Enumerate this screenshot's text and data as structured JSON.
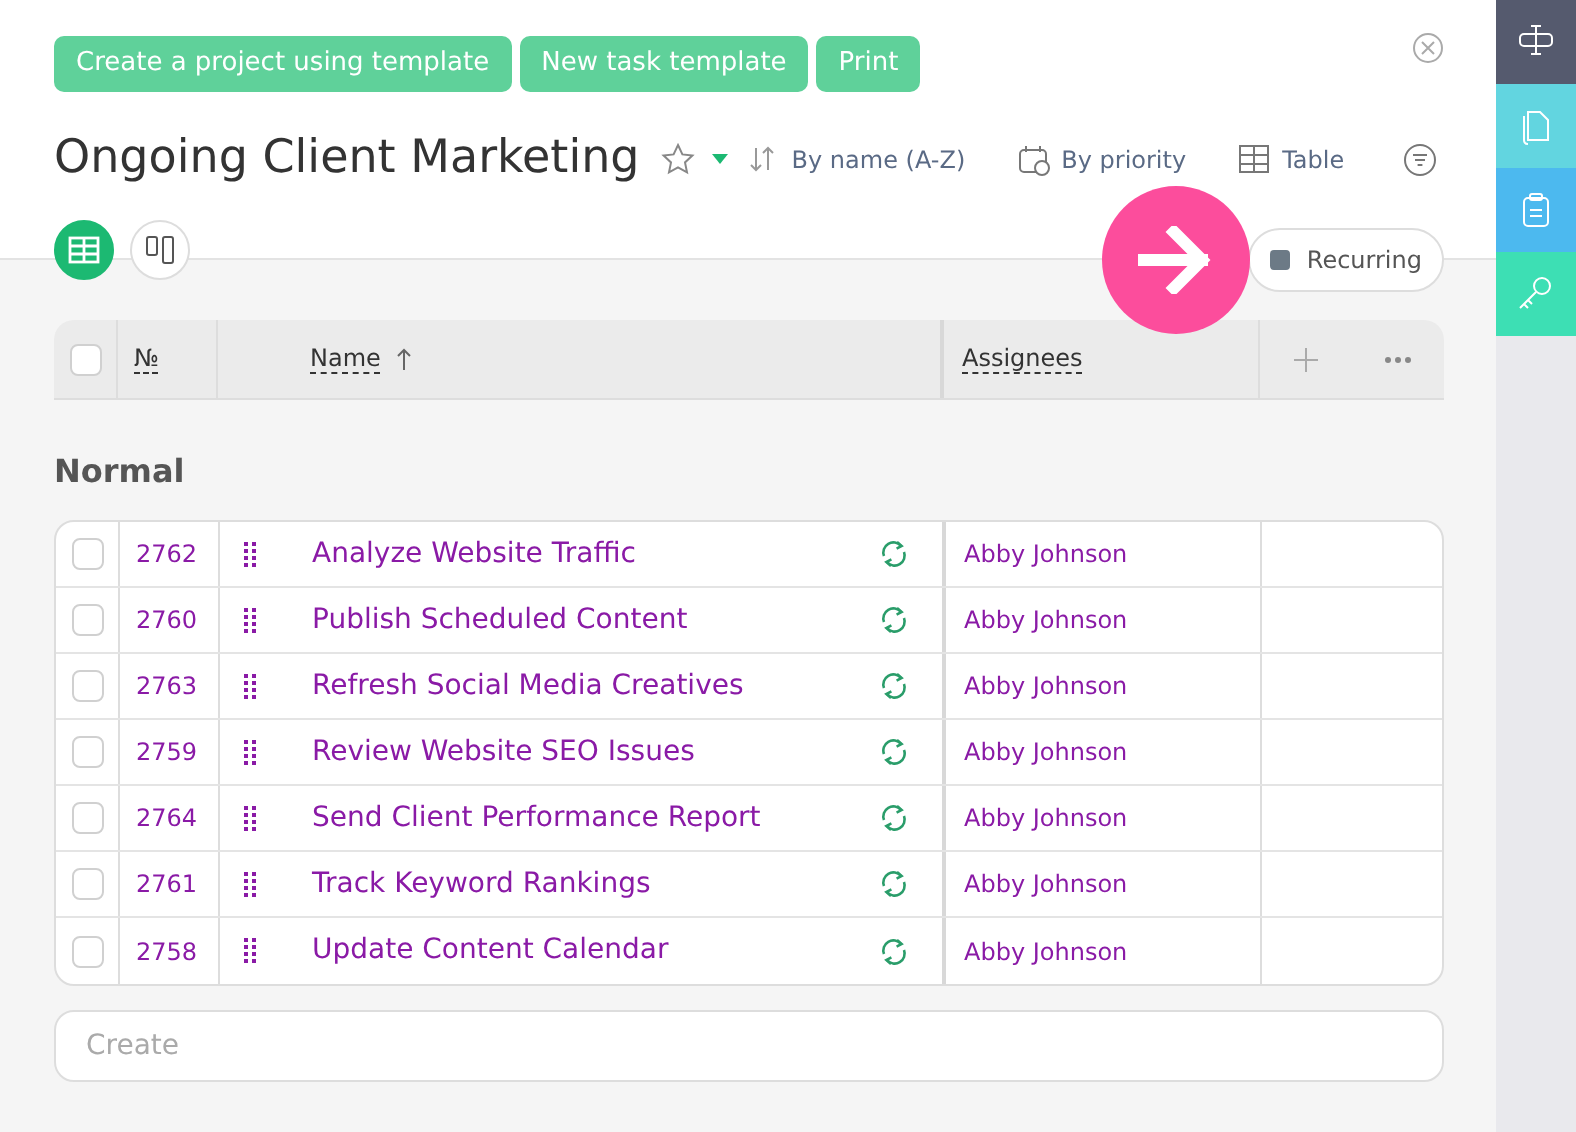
{
  "toolbar": {
    "buttons": [
      "Create a project using template",
      "New task template",
      "Print"
    ]
  },
  "project": {
    "title": "Ongoing Client Marketing",
    "starred": false
  },
  "view_options": [
    {
      "kind": "sort",
      "label": "By name (A-Z)"
    },
    {
      "kind": "priority",
      "label": "By priority"
    },
    {
      "kind": "table",
      "label": "Table"
    },
    {
      "kind": "filter"
    }
  ],
  "view_switch": [
    {
      "kind": "table",
      "selected": true
    },
    {
      "kind": "board",
      "selected": false
    }
  ],
  "recurring_filter": {
    "label": "Recurring",
    "checked": true
  },
  "table": {
    "columns": [
      {
        "label": "№"
      },
      {
        "label": "Name",
        "sorted": true
      },
      {
        "label": "Assignees"
      }
    ],
    "all_checked": false,
    "group": "Normal",
    "rows": [
      {
        "number": "2762",
        "name": "Analyze Website Traffic",
        "recurring": true,
        "assignee": "Abby Johnson",
        "checked": false
      },
      {
        "number": "2760",
        "name": "Publish Scheduled Content",
        "recurring": true,
        "assignee": "Abby Johnson",
        "checked": false
      },
      {
        "number": "2763",
        "name": "Refresh Social Media Creatives",
        "recurring": true,
        "assignee": "Abby Johnson",
        "checked": false
      },
      {
        "number": "2759",
        "name": "Review Website SEO Issues",
        "recurring": true,
        "assignee": "Abby Johnson",
        "checked": false
      },
      {
        "number": "2764",
        "name": "Send Client Performance Report",
        "recurring": true,
        "assignee": "Abby Johnson",
        "checked": false
      },
      {
        "number": "2761",
        "name": "Track Keyword Rankings",
        "recurring": true,
        "assignee": "Abby Johnson",
        "checked": false
      },
      {
        "number": "2758",
        "name": "Update Content Calendar",
        "recurring": true,
        "assignee": "Abby Johnson",
        "checked": false
      }
    ]
  },
  "create": {
    "placeholder": "Create"
  },
  "side_panel": [
    {
      "kind": "text",
      "color": "#555a6e"
    },
    {
      "kind": "docs",
      "color": "#62d5e0"
    },
    {
      "kind": "clipboard",
      "color": "#4cb9ef"
    },
    {
      "kind": "key",
      "color": "#3ddfb4"
    }
  ]
}
